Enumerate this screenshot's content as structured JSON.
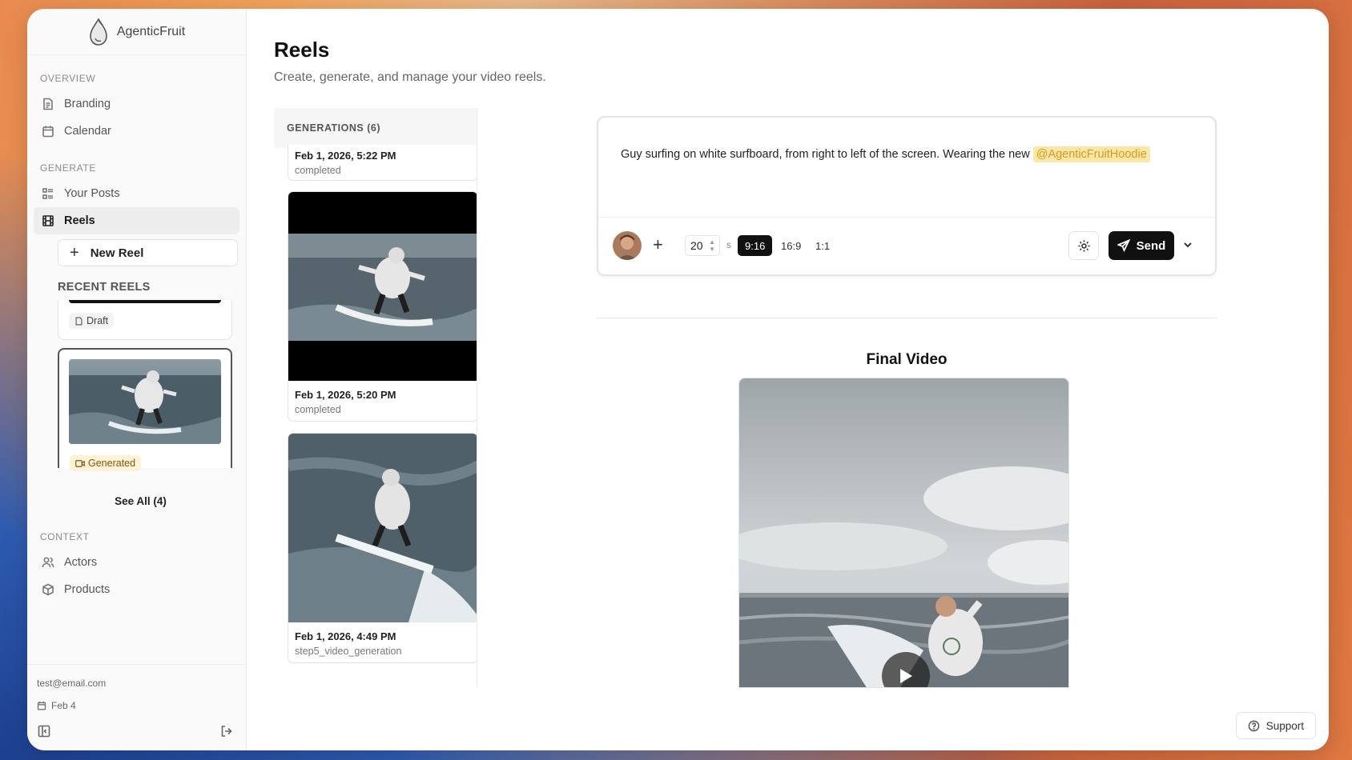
{
  "app": {
    "name": "AgenticFruit"
  },
  "sidebar": {
    "sections": [
      {
        "label": "OVERVIEW",
        "items": [
          {
            "label": "Branding",
            "icon": "document-icon"
          },
          {
            "label": "Calendar",
            "icon": "calendar-icon"
          }
        ]
      },
      {
        "label": "GENERATE",
        "items": [
          {
            "label": "Your Posts",
            "icon": "list-icon"
          },
          {
            "label": "Reels",
            "icon": "film-icon",
            "active": true
          }
        ]
      },
      {
        "label": "CONTEXT",
        "items": [
          {
            "label": "Actors",
            "icon": "users-icon"
          },
          {
            "label": "Products",
            "icon": "box-icon"
          }
        ]
      }
    ],
    "new_reel_label": "New Reel",
    "recent_reels_label": "RECENT REELS",
    "recent_reels": [
      {
        "status": "Draft"
      },
      {
        "status": "Generated"
      }
    ],
    "see_all_label": "See All (4)",
    "footer": {
      "email": "test@email.com",
      "date": "Feb 4"
    }
  },
  "page": {
    "title": "Reels",
    "subtitle": "Create, generate, and manage your video reels."
  },
  "generations": {
    "header": "GENERATIONS (6)",
    "items": [
      {
        "date": "Feb 1, 2026, 5:22 PM",
        "status": "completed"
      },
      {
        "date": "Feb 1, 2026, 5:20 PM",
        "status": "completed"
      },
      {
        "date": "Feb 1, 2026, 4:49 PM",
        "status": "step5_video_generation"
      }
    ]
  },
  "composer": {
    "prompt_text": "Guy surfing on white surfboard, from right to left of the screen. Wearing the new",
    "mention": "@AgenticFruitHoodie",
    "duration_value": "20",
    "duration_unit": "s",
    "aspect_ratios": [
      "9:16",
      "16:9",
      "1:1"
    ],
    "selected_ratio": "9:16",
    "send_label": "Send"
  },
  "final_video": {
    "title": "Final Video"
  },
  "support_label": "Support",
  "colors": {
    "accent": "#111111",
    "mention_bg": "#fde7a8",
    "generated_badge": "#fdf1d6"
  }
}
